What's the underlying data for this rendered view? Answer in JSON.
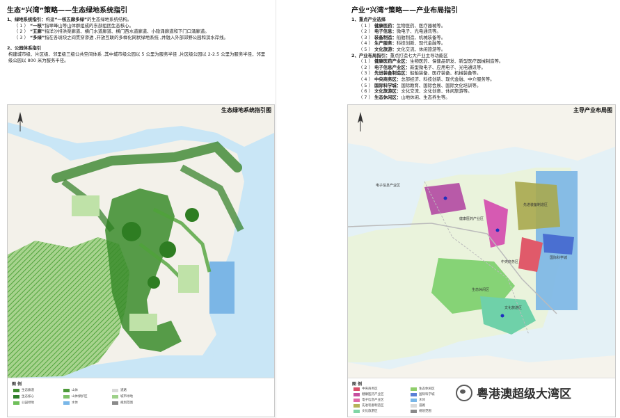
{
  "left": {
    "title": "生态“兴湾”策略——生态绿地系统指引",
    "sec1_title": "1、绿地系统指引：",
    "sec1_intro": "构建",
    "sec1_kw": "“一核五廊多绿”",
    "sec1_tail": "的生态绿地系统结构。",
    "items": [
      {
        "num": "（ 1 ）",
        "kw": "“一核”",
        "text": "指翠峰山等山体群组成的东部组团生态核心。"
      },
      {
        "num": "（ 2 ）",
        "kw": "“五廊”",
        "text": "指洋沙排洪渠廊道、横门水道廊道、横门西水道廊道、小隐涌廊道和下门口涌廊道。"
      },
      {
        "num": "（ 3 ）",
        "kw": "“多绿”",
        "text": "指在各斑块之间贯穿渗透 ,开放互联的多样化网状绿地系统 ,并融入外部郊野公园和滨水岸线。"
      }
    ],
    "sec2_title": "2、公园体系指引",
    "sec2_text": "构建城市级、片区级、邻里级三级公共空间体系 ,其中城市级公园以 5 公里为服务半径 ,片区级公园以 2-2.5 公里为服务半径，邻里级公园以 800 米为服务半径。",
    "map_title": "生态绿地系统指引图",
    "legend_title": "图  例",
    "legend": [
      {
        "label": "生态廊道",
        "color": "#3f8f2f"
      },
      {
        "label": "山体",
        "color": "#4d9a3a"
      },
      {
        "label": "道路",
        "color": "#d9d9d9"
      },
      {
        "label": "生态核心",
        "color": "#2f7f2a"
      },
      {
        "label": "山体保护区",
        "color": "#7fc16a"
      },
      {
        "label": "城市绿地",
        "color": "#9ed18a"
      },
      {
        "label": "公园绿地",
        "color": "#6fbf5a"
      },
      {
        "label": "水体",
        "color": "#79b7e8"
      },
      {
        "label": "规划范围",
        "color": "#8a8a8a"
      }
    ],
    "colors": {
      "green_dark": "#2e7d22",
      "green_mid": "#4fa33a",
      "green_light": "#bfe2a8",
      "water": "#c9e6f6",
      "sea": "#7bb6e6"
    }
  },
  "right": {
    "title": "产业“兴湾”策略——产业布局指引",
    "sec1_title": "1、重点产业选择",
    "industries": [
      {
        "num": "（ 1 ）",
        "name": "健康医药：",
        "text": "生物医药、医疗器械等。"
      },
      {
        "num": "（ 2 ）",
        "name": "电子信息：",
        "text": "微电子、光电通讯等。"
      },
      {
        "num": "（ 3 ）",
        "name": "装备制造：",
        "text": "船舶制造、机械装备等。"
      },
      {
        "num": "（ 4 ）",
        "name": "生产服务：",
        "text": "科技创新、现代金融等。"
      },
      {
        "num": "（ 5 ）",
        "name": "文化旅游：",
        "text": "文化交流、休闲旅游等。"
      }
    ],
    "sec2_title": "2、产业布局指引：",
    "sec2_intro": "重点打造七大产业主导功能区",
    "zones": [
      {
        "num": "（ 1 ）",
        "name": "健康医药产业区：",
        "text": "生物医药、保健品研发、新型医疗器械制造等。"
      },
      {
        "num": "（ 2 ）",
        "name": "电子信息产业区：",
        "text": "新型微电子、应用电子、光电通讯等。"
      },
      {
        "num": "（ 3 ）",
        "name": "先进装备制造区：",
        "text": "船舶装备、医疗装备、机械装备等。"
      },
      {
        "num": "（ 4 ）",
        "name": "中央商务区：",
        "text": "总部经济、科技创新、现代金融、中介服务等。"
      },
      {
        "num": "（ 5 ）",
        "name": "国际科学城：",
        "text": "国际教育、国际会展、国际文化培训等。"
      },
      {
        "num": "（ 6 ）",
        "name": "文化旅游区：",
        "text": "文化交流、文化创意、休闲旅游等。"
      },
      {
        "num": "（ 7 ）",
        "name": "生态休闲区：",
        "text": "山地休闲、生态养生等。"
      }
    ],
    "map_title": "主导产业布局图",
    "map_labels": {
      "electronics": "电子信息产业区",
      "health": "健康医药产业区",
      "equipment": "先进装备制造区",
      "cbd": "中央商务区",
      "science": "国际科学城",
      "eco": "生态休闲区",
      "culture": "文化旅游区"
    },
    "legend_title": "图  例",
    "legend": [
      {
        "label": "中央商务区",
        "color": "#d94f6a"
      },
      {
        "label": "健康医药产业区",
        "color": "#c64fa0"
      },
      {
        "label": "电子信息产业区",
        "color": "#e06aa8"
      },
      {
        "label": "先进装备制造区",
        "color": "#b5b35a"
      },
      {
        "label": "文化旅游区",
        "color": "#7fd6a6"
      },
      {
        "label": "生态休闲区",
        "color": "#8fce6a"
      },
      {
        "label": "国际科学城",
        "color": "#5a7fd6"
      },
      {
        "label": "水体",
        "color": "#79b7e8"
      },
      {
        "label": "道路",
        "color": "#d9d9d9"
      },
      {
        "label": "规划范围",
        "color": "#8a8a8a"
      }
    ],
    "colors": {
      "purple": "#b85aa8",
      "magenta": "#d65ab2",
      "olive": "#a9a84e",
      "blue": "#4a6fd1",
      "red": "#e05a6a",
      "teal": "#6fd1a9",
      "green": "#7bcf6a",
      "sea": "#7bb6e6"
    }
  },
  "watermark": {
    "text": "粤港澳超级大湾区",
    "icon": "wechat-icon"
  }
}
